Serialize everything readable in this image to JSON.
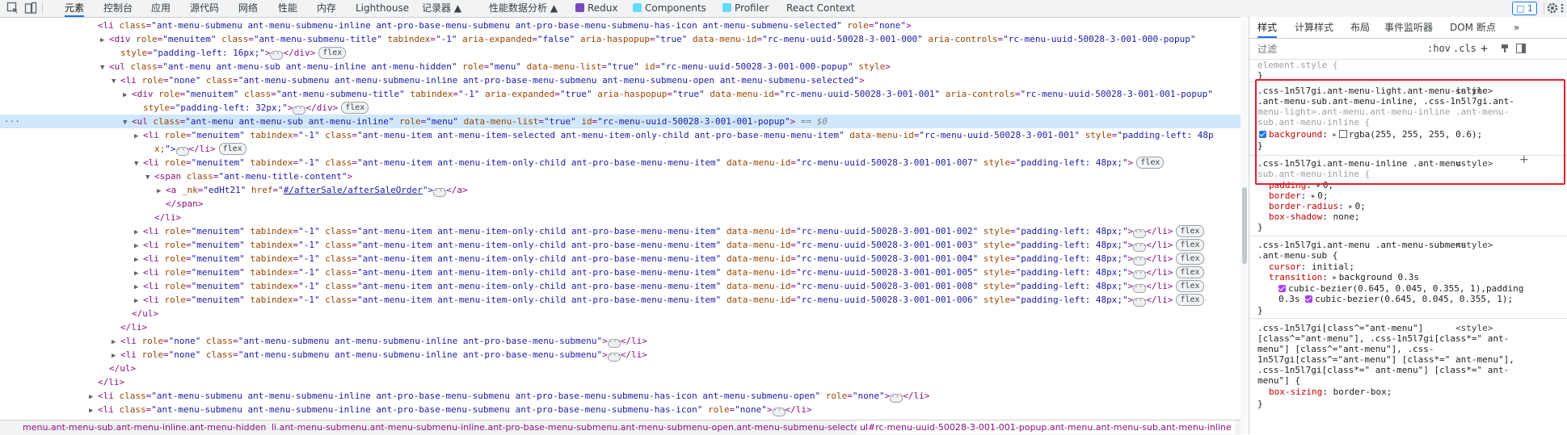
{
  "toolbar": {
    "tabs": [
      {
        "label": "元素",
        "active": true
      },
      {
        "label": "控制台"
      },
      {
        "label": "应用"
      },
      {
        "label": "源代码"
      },
      {
        "label": "网络"
      },
      {
        "label": "性能"
      },
      {
        "label": "内存"
      },
      {
        "label": "Lighthouse"
      },
      {
        "label": "记录器 ▲"
      },
      {
        "label": "性能数据分析 ▲"
      },
      {
        "label": "Redux"
      },
      {
        "label": "Components"
      },
      {
        "label": "Profiler"
      },
      {
        "label": "React Context"
      }
    ],
    "issues_count": "1",
    "colors": {
      "accent": "#1a73e8",
      "highlight": "#e8192c"
    },
    "icons": [
      "inspect-icon",
      "device-toolbar-icon",
      "more-tabs-icon",
      "issues-icon",
      "settings-icon",
      "more-menu-icon",
      "close-icon"
    ]
  },
  "dom": {
    "lines": [
      {
        "indent": 8,
        "tw": "",
        "text": "<li class=\"ant-menu-submenu ant-menu-submenu-inline ant-pro-base-menu-submenu ant-pro-base-menu-submenu-has-icon ant-menu-submenu-selected\" role=\"none\">"
      },
      {
        "indent": 9,
        "tw": "▶",
        "text": "<div role=\"menuitem\" class=\"ant-menu-submenu-title\" tabindex=\"-1\" aria-expanded=\"false\" aria-haspopup=\"true\" data-menu-id=\"rc-menu-uuid-50028-3-001-000\" aria-controls=\"rc-menu-uuid-50028-3-001-000-popup\""
      },
      {
        "indent": 10,
        "tw": "",
        "text": "style=\"padding-left: 16px;\">",
        "ellipsis": true,
        "after": "</div>",
        "flex": true
      },
      {
        "indent": 9,
        "tw": "▼",
        "text": "<ul class=\"ant-menu ant-menu-sub ant-menu-inline ant-menu-hidden\" role=\"menu\" data-menu-list=\"true\" id=\"rc-menu-uuid-50028-3-001-000-popup\" style>"
      },
      {
        "indent": 10,
        "tw": "▼",
        "text": "<li role=\"none\" class=\"ant-menu-submenu ant-menu-submenu-inline ant-pro-base-menu-submenu ant-menu-submenu-open ant-menu-submenu-selected\">"
      },
      {
        "indent": 11,
        "tw": "▶",
        "text": "<div role=\"menuitem\" class=\"ant-menu-submenu-title\" tabindex=\"-1\" aria-expanded=\"true\" aria-haspopup=\"true\" data-menu-id=\"rc-menu-uuid-50028-3-001-001\" aria-controls=\"rc-menu-uuid-50028-3-001-001-popup\""
      },
      {
        "indent": 12,
        "tw": "",
        "text": "style=\"padding-left: 32px;\">",
        "ellipsis": true,
        "after": "</div>",
        "flex": true
      },
      {
        "indent": 11,
        "tw": "▼",
        "text": "<ul class=\"ant-menu ant-menu-sub ant-menu-inline\" role=\"menu\" data-menu-list=\"true\" id=\"rc-menu-uuid-50028-3-001-001-popup\">",
        "dollar": "== $0",
        "selected": true
      },
      {
        "indent": 12,
        "tw": "▶",
        "text": "<li role=\"menuitem\" tabindex=\"-1\" class=\"ant-menu-item ant-menu-item-selected ant-menu-item-only-child ant-pro-base-menu-menu-item\" data-menu-id=\"rc-menu-uuid-50028-3-001-001\" style=\"padding-left: 48p"
      },
      {
        "indent": 13,
        "tw": "",
        "text": "x;\">",
        "ellipsis": true,
        "after": "</li>",
        "flex": true
      },
      {
        "indent": 12,
        "tw": "▼",
        "text": "<li role=\"menuitem\" tabindex=\"-1\" class=\"ant-menu-item ant-menu-item-only-child ant-pro-base-menu-menu-item\" data-menu-id=\"rc-menu-uuid-50028-3-001-001-007\" style=\"padding-left: 48px;\">",
        "flex": true
      },
      {
        "indent": 13,
        "tw": "▼",
        "text": "<span class=\"ant-menu-title-content\">"
      },
      {
        "indent": 14,
        "tw": "▶",
        "text": "<a _nk=\"edHt21\" href=\"",
        "link": "#/afterSale/afterSaleOrder",
        "after_link": "\">",
        "ellipsis": true,
        "after": "</a>"
      },
      {
        "indent": 14,
        "tw": "",
        "text": "</span>"
      },
      {
        "indent": 13,
        "tw": "",
        "text": "</li>"
      },
      {
        "indent": 12,
        "tw": "▶",
        "text": "<li role=\"menuitem\" tabindex=\"-1\" class=\"ant-menu-item ant-menu-item-only-child ant-pro-base-menu-menu-item\" data-menu-id=\"rc-menu-uuid-50028-3-001-001-002\" style=\"padding-left: 48px;\">",
        "ellipsis": true,
        "after": "</li>",
        "flex": true
      },
      {
        "indent": 12,
        "tw": "▶",
        "text": "<li role=\"menuitem\" tabindex=\"-1\" class=\"ant-menu-item ant-menu-item-only-child ant-pro-base-menu-menu-item\" data-menu-id=\"rc-menu-uuid-50028-3-001-001-003\" style=\"padding-left: 48px;\">",
        "ellipsis": true,
        "after": "</li>",
        "flex": true
      },
      {
        "indent": 12,
        "tw": "▶",
        "text": "<li role=\"menuitem\" tabindex=\"-1\" class=\"ant-menu-item ant-menu-item-only-child ant-pro-base-menu-menu-item\" data-menu-id=\"rc-menu-uuid-50028-3-001-001-004\" style=\"padding-left: 48px;\">",
        "ellipsis": true,
        "after": "</li>",
        "flex": true
      },
      {
        "indent": 12,
        "tw": "▶",
        "text": "<li role=\"menuitem\" tabindex=\"-1\" class=\"ant-menu-item ant-menu-item-only-child ant-pro-base-menu-menu-item\" data-menu-id=\"rc-menu-uuid-50028-3-001-001-005\" style=\"padding-left: 48px;\">",
        "ellipsis": true,
        "after": "</li>",
        "flex": true
      },
      {
        "indent": 12,
        "tw": "▶",
        "text": "<li role=\"menuitem\" tabindex=\"-1\" class=\"ant-menu-item ant-menu-item-only-child ant-pro-base-menu-menu-item\" data-menu-id=\"rc-menu-uuid-50028-3-001-001-008\" style=\"padding-left: 48px;\">",
        "ellipsis": true,
        "after": "</li>",
        "flex": true
      },
      {
        "indent": 12,
        "tw": "▶",
        "text": "<li role=\"menuitem\" tabindex=\"-1\" class=\"ant-menu-item ant-menu-item-only-child ant-pro-base-menu-menu-item\" data-menu-id=\"rc-menu-uuid-50028-3-001-001-006\" style=\"padding-left: 48px;\">",
        "ellipsis": true,
        "after": "</li>",
        "flex": true
      },
      {
        "indent": 11,
        "tw": "",
        "text": "</ul>"
      },
      {
        "indent": 10,
        "tw": "",
        "text": "</li>"
      },
      {
        "indent": 10,
        "tw": "▶",
        "text": "<li role=\"none\" class=\"ant-menu-submenu ant-menu-submenu-inline ant-pro-base-menu-submenu\">",
        "ellipsis": true,
        "after": "</li>"
      },
      {
        "indent": 10,
        "tw": "▶",
        "text": "<li role=\"none\" class=\"ant-menu-submenu ant-menu-submenu-inline ant-pro-base-menu-submenu\">",
        "ellipsis": true,
        "after": "</li>"
      },
      {
        "indent": 9,
        "tw": "",
        "text": "</ul>"
      },
      {
        "indent": 8,
        "tw": "",
        "text": "</li>"
      },
      {
        "indent": 8,
        "tw": "▶",
        "text": "<li class=\"ant-menu-submenu ant-menu-submenu-inline ant-pro-base-menu-submenu ant-pro-base-menu-submenu-has-icon ant-menu-submenu-open\" role=\"none\">",
        "ellipsis": true,
        "after": "</li>"
      },
      {
        "indent": 8,
        "tw": "▶",
        "text": "<li class=\"ant-menu-submenu ant-menu-submenu-inline ant-pro-base-menu-submenu ant-pro-base-menu-submenu-has-icon\" role=\"none\">",
        "ellipsis": true,
        "after": "</li>"
      }
    ]
  },
  "breadcrumbs": [
    {
      "label": "menu.ant-menu-sub.ant-menu-inline.ant-menu-hidden"
    },
    {
      "label": "li.ant-menu-submenu.ant-menu-submenu-inline.ant-pro-base-menu-submenu.ant-menu-submenu-open.ant-menu-submenu-selected"
    },
    {
      "label": "ul#rc-menu-uuid-50028-3-001-001-popup.ant-menu.ant-menu-sub.ant-menu-inline",
      "selected": true
    }
  ],
  "styles": {
    "tabs": [
      {
        "label": "样式",
        "active": true
      },
      {
        "label": "计算样式"
      },
      {
        "label": "布局"
      },
      {
        "label": "事件监听器"
      },
      {
        "label": "DOM 断点"
      },
      {
        "label": "»"
      }
    ],
    "filter_placeholder": "过滤",
    "hov": ":hov",
    "cls": ".cls",
    "plus": "+",
    "element_style": "element.style {",
    "close_brace": "}",
    "origin": "<style>",
    "rule1": {
      "selector_lines": [
        ".css-1n5l7gi.ant-menu-light.ant-menu-inline",
        ".ant-menu-sub.ant-menu-inline, .css-1n5l7gi.ant-",
        "menu-light>.ant-menu.ant-menu-inline .ant-menu-",
        "sub.ant-menu-inline {"
      ],
      "prop": "background",
      "value": "rgba(255, 255, 255, 0.6);"
    },
    "rule2": {
      "selector_lines": [
        ".css-1n5l7gi.ant-menu-inline .ant-menu-",
        "sub.ant-menu-inline {"
      ],
      "props": [
        {
          "name": "padding",
          "value": "0;",
          "tri": true
        },
        {
          "name": "border",
          "value": "0;",
          "tri": true
        },
        {
          "name": "border-radius",
          "value": "0;",
          "tri": true
        },
        {
          "name": "box-shadow",
          "value": "none;"
        }
      ]
    },
    "rule3": {
      "selector_lines": [
        ".css-1n5l7gi.ant-menu .ant-menu-submenu",
        ".ant-menu-sub {"
      ],
      "cursor": {
        "name": "cursor",
        "value": "initial;"
      },
      "transition": {
        "name": "transition",
        "value": "background 0.3s"
      },
      "bezier1": "cubic-bezier(0.645, 0.045, 0.355, 1),padding",
      "bezier2_prefix": "0.3s",
      "bezier2": "cubic-bezier(0.645, 0.045, 0.355, 1);"
    },
    "rule4": {
      "selector_lines": [
        ".css-1n5l7gi[class^=\"ant-menu\"]",
        "[class^=\"ant-menu\"], .css-1n5l7gi[class*=\" ant-",
        "menu\"] [class^=\"ant-menu\"], .css-",
        "1n5l7gi[class^=\"ant-menu\"] [class*=\" ant-menu\"],",
        ".css-1n5l7gi[class*=\" ant-menu\"] [class*=\" ant-",
        "menu\"] {"
      ],
      "prop": "box-sizing",
      "value": "border-box;"
    }
  }
}
